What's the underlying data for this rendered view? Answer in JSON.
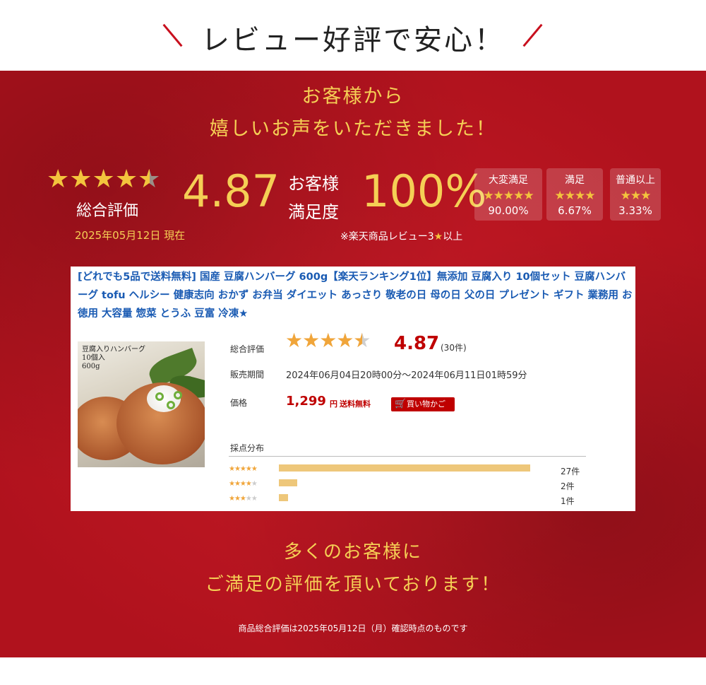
{
  "header": {
    "title": "レビュー好評で安心！"
  },
  "intro": {
    "line1": "お客様から",
    "line2": "嬉しいお声をいただきました！"
  },
  "summary": {
    "stars_value": 4.87,
    "overall_label": "総合評価",
    "score": "4.87",
    "satisfaction_label_1": "お客様",
    "satisfaction_label_2": "満足度",
    "satisfaction_pct": "100%",
    "as_of": "2025年05月12日 現在",
    "note_prefix": "※楽天商品レビュー3",
    "note_suffix": "以上",
    "distribution": [
      {
        "label": "大変満足",
        "stars": "★★★★★",
        "pct": "90.00%"
      },
      {
        "label": "満足",
        "stars": "★★★★",
        "pct": "6.67%"
      },
      {
        "label": "普通以上",
        "stars": "★★★",
        "pct": "3.33%"
      }
    ]
  },
  "card": {
    "product_title": "[どれでも5品で送料無料] 国産 豆腐ハンバーグ 600g【楽天ランキング1位】無添加 豆腐入り 10個セット 豆腐ハンバーグ tofu ヘルシー 健康志向 おかず お弁当 ダイエット あっさり 敬老の日 母の日 父の日 プレゼント ギフト 業務用 お徳用 大容量 惣菜 とうふ 豆富 冷凍★",
    "photo_text": [
      "豆腐入りハンバーグ",
      "10個入",
      "600g"
    ],
    "overall_label": "総合評価",
    "score": "4.87",
    "review_count": "(30件)",
    "period_label": "販売期間",
    "period": "2024年06月04日20時00分～2024年06月11日01時59分",
    "price_label": "価格",
    "price": "1,299",
    "price_unit": "円",
    "shipping": "送料無料",
    "cart_button": "買い物かご",
    "distribution_title": "採点分布",
    "rows": [
      {
        "stars_on": "★★★★★",
        "stars_off": "",
        "count": "27件",
        "fraction": 0.9
      },
      {
        "stars_on": "★★★★",
        "stars_off": "★",
        "count": "2件",
        "fraction": 0.067
      },
      {
        "stars_on": "★★★",
        "stars_off": "★★",
        "count": "1件",
        "fraction": 0.033
      }
    ]
  },
  "closing": {
    "line1": "多くのお客様に",
    "line2": "ご満足の評価を頂いております！"
  },
  "footnote": "商品総合評価は2025年05月12日（月）確認時点のものです",
  "colors": {
    "red_bg": "#c01a24",
    "gold": "#f5cf55",
    "star": "#f3c43d",
    "price_red": "#bf0000",
    "link_blue": "#1a5bb3"
  }
}
